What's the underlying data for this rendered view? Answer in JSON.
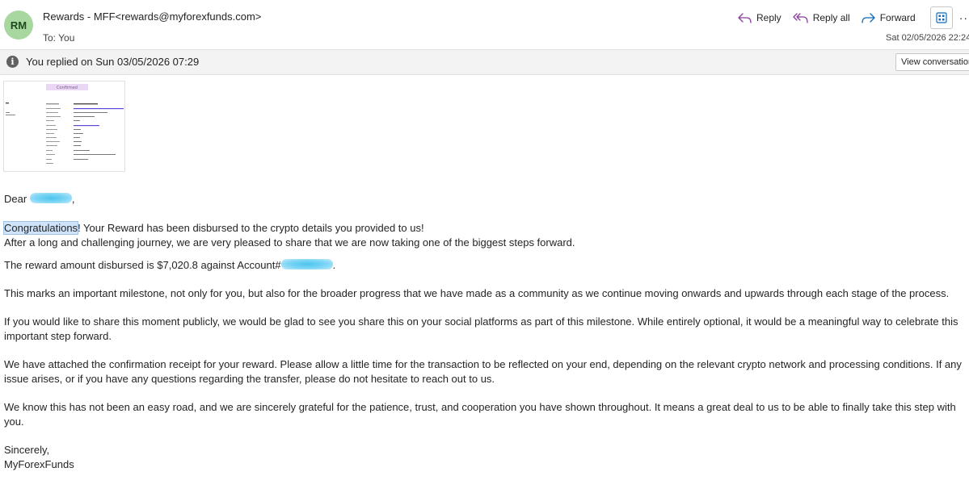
{
  "header": {
    "avatar_initials": "RM",
    "from": "Rewards - MFF<rewards@myforexfunds.com>",
    "to": "To:  You",
    "date": "Sat 02/05/2026 22:24"
  },
  "actions": {
    "reply": "Reply",
    "reply_all": "Reply all",
    "forward": "Forward",
    "more": "···"
  },
  "infobar": {
    "text": "You replied on Sun 03/05/2026 07:29",
    "view_button": "View conversation"
  },
  "thumbnail": {
    "header_text": "Confirmed"
  },
  "body": {
    "greeting": "Dear",
    "greeting_suffix": ",",
    "congrats_word": "Congratulations",
    "congrats_rest": "! Your Reward has been disbursed to the crypto details you provided to us!",
    "line2": "After a long and challenging journey, we are very pleased to share that we are now taking one of the biggest steps forward.",
    "amount_line": "The reward amount disbursed is $7,020.8 against Account#",
    "amount_suffix": ".",
    "para_milestone": "This marks an important milestone, not only for you, but also for the broader progress that we have made as a community as we continue moving onwards and upwards through each stage of the process.",
    "para_share": "If you would like to share this moment publicly, we would be glad to see you share this on your social platforms as part of this milestone. While entirely optional, it would be a meaningful way to celebrate this important step forward.",
    "para_receipt": "We have attached the confirmation receipt for your reward. Please allow a little time for the transaction to be reflected on your end, depending on the relevant crypto network and processing conditions. If any issue arises, or if you have any questions regarding the transfer, please do not hesitate to reach out to us.",
    "para_grateful": "We know this has not been an easy road, and we are sincerely grateful for the patience, trust, and cooperation you have shown throughout. It means a great deal to us to be able to finally take this step with you.",
    "closing": "Sincerely,",
    "signature": "MyForexFunds"
  },
  "colors": {
    "accent": "#0f6cbd",
    "avatar_bg": "#a8d8a0",
    "redaction": "#4cc4ee",
    "reply_icon": "#8a3d9c"
  }
}
